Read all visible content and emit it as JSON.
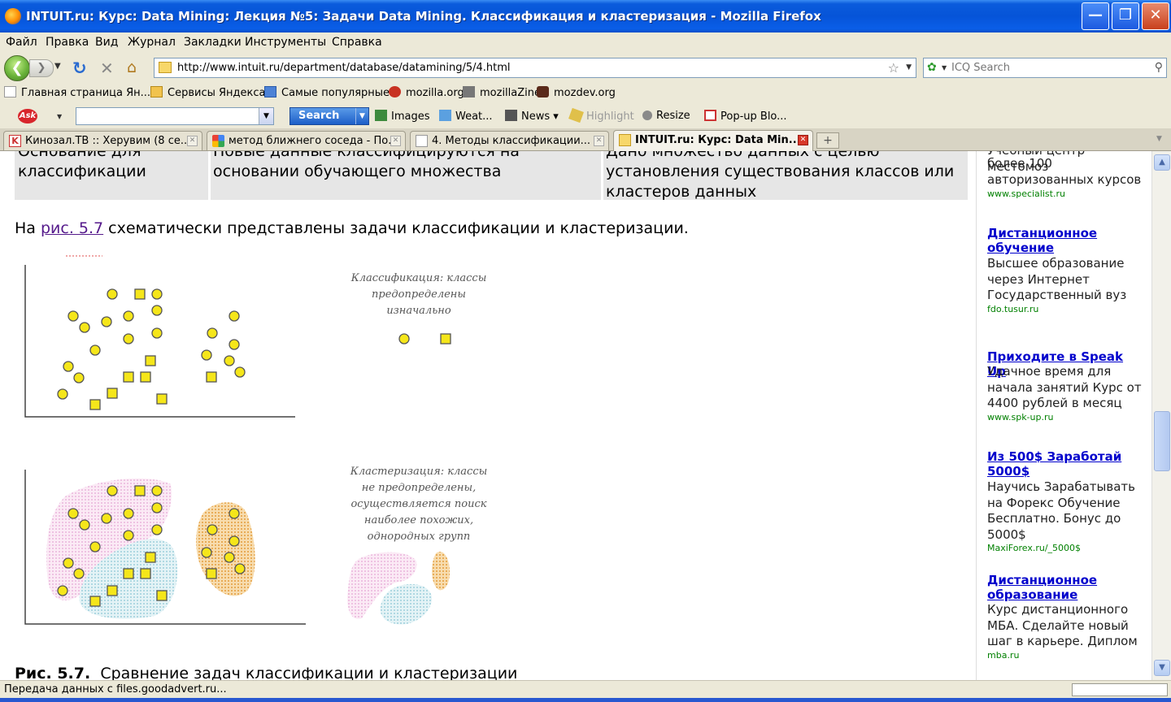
{
  "window": {
    "title": "INTUIT.ru: Курс: Data Mining: Лекция №5: Задачи Data Mining. Классификация и кластеризация - Mozilla Firefox",
    "min_label": "—",
    "max_label": "❐",
    "close_label": "✕"
  },
  "menu": [
    "Файл",
    "Правка",
    "Вид",
    "Журнал",
    "Закладки",
    "Инструменты",
    "Справка"
  ],
  "nav": {
    "back_label": "❮",
    "forward_label": "❯",
    "url": "http://www.intuit.ru/department/database/datamining/5/4.html",
    "search_placeholder": "ICQ Search"
  },
  "bookmarks": [
    "Главная страница Ян...",
    "Сервисы Яндекса",
    "Самые популярные",
    "mozilla.org",
    "mozillaZine",
    "mozdev.org"
  ],
  "ask_toolbar": {
    "logo": "Ask",
    "search_button": "Search",
    "tools": [
      "Images",
      "Weat...",
      "News",
      "Highlight",
      "Resize",
      "Pop-up Blo..."
    ]
  },
  "tabs": [
    {
      "label": "Кинозал.ТВ :: Херувим (8 се...",
      "icon": "K"
    },
    {
      "label": "метод ближнего соседа - По...",
      "icon": ""
    },
    {
      "label": "4. Методы классификации...",
      "icon": ""
    },
    {
      "label": "INTUIT.ru: Курс: Data Min...",
      "icon": ""
    }
  ],
  "table_row": {
    "col1": "Основание для классификации",
    "col2": "Новые данные классифицируются на основании обучающего множества",
    "col3": "Дано множество данных с целью установления существования классов или кластеров данных"
  },
  "paragraph": {
    "before": "На ",
    "link": "рис. 5.7",
    "after": " схематически представлены задачи классификации и кластеризации."
  },
  "figure": {
    "classification_label": [
      "Классификация: классы",
      "предопределены",
      "изначально"
    ],
    "clustering_label": [
      "Кластеризация: классы",
      "не предопределены,",
      "осуществляется поиск",
      "наиболее похожих,",
      "однородных групп"
    ],
    "circle_color": "#f5e61a",
    "square_color": "#f5e61a",
    "pink_cluster": "#f2cfe8",
    "blue_cluster": "#c4e4ea",
    "orange_cluster": "#f0b860"
  },
  "caption": {
    "label": "Рис. 5.7.",
    "text": "Сравнение задач классификации и кластеризации"
  },
  "ads": [
    {
      "title": "",
      "text": "более 100 авторизованных курсов",
      "url": "www.specialist.ru"
    },
    {
      "title": "Дистанционное обучение",
      "text": "Высшее образование через Интернет Государственный вуз",
      "url": "fdo.tusur.ru"
    },
    {
      "title": "Приходите в Speak Up",
      "text": "Удачное время для начала занятий Курс от 4400 рублей в месяц",
      "url": "www.spk-up.ru"
    },
    {
      "title": "Из 500$ Заработай 5000$",
      "text": "Научись Зарабатывать на Форекс Обучение Бесплатно. Бонус до 5000$",
      "url": "MaxiForex.ru/_5000$"
    },
    {
      "title": "Дистанционное образование",
      "text": "Курс дистанционного МБА. Сделайте новый шаг в карьере. Диплом",
      "url": "mba.ru"
    }
  ],
  "ads_top_fragment": "Учебный центр местомоз",
  "status": "Передача данных с files.goodadvert.ru..."
}
